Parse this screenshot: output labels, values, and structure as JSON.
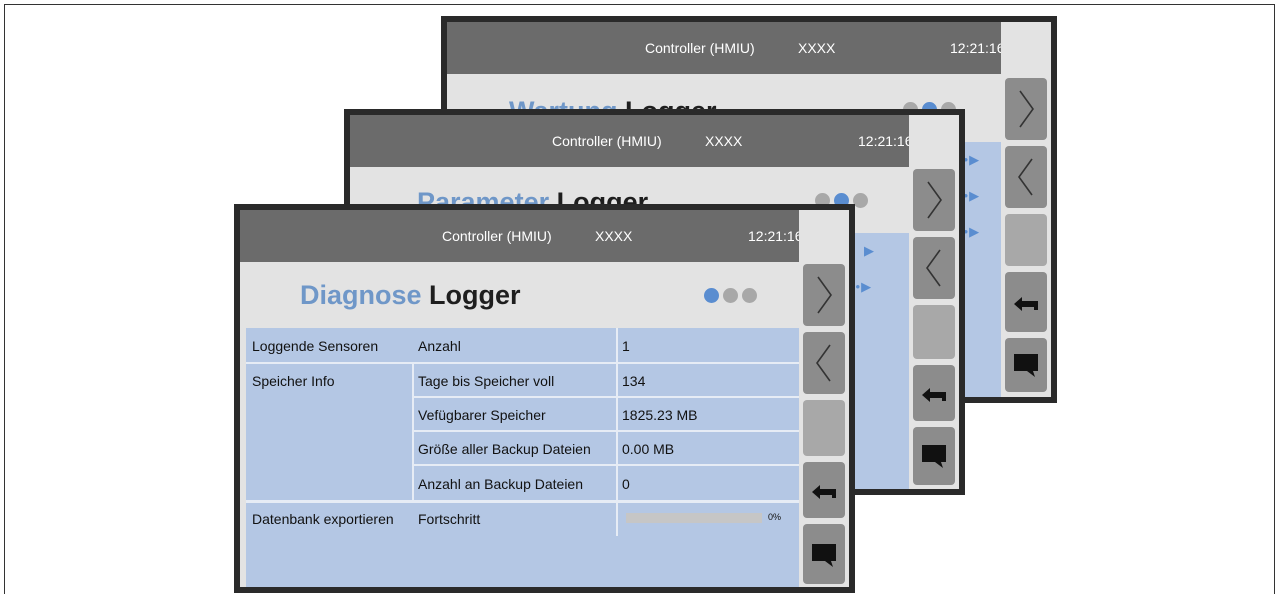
{
  "screens": {
    "back": {
      "header": {
        "controller": "Controller (HMIU)",
        "id": "XXXX",
        "time": "12:21:16"
      },
      "title_part1": "Wartung",
      "title_part2": "Logger",
      "page_indicator": {
        "count": 3,
        "active": 2
      }
    },
    "middle": {
      "header": {
        "controller": "Controller (HMIU)",
        "id": "XXXX",
        "time": "12:21:16"
      },
      "title_part1": "Parameter",
      "title_part2": "Logger",
      "page_indicator": {
        "count": 3,
        "active": 2
      }
    },
    "front": {
      "header": {
        "controller": "Controller (HMIU)",
        "id": "XXXX",
        "time": "12:21:16"
      },
      "title_part1": "Diagnose",
      "title_part2": "Logger",
      "page_indicator": {
        "count": 3,
        "active": 1
      },
      "table": {
        "groups": [
          {
            "label": "Loggende Sensoren",
            "rows": [
              {
                "field": "Anzahl",
                "value": "1"
              }
            ]
          },
          {
            "label": "Speicher Info",
            "rows": [
              {
                "field": "Tage bis Speicher voll",
                "value": "134"
              },
              {
                "field": "Vefügbarer Speicher",
                "value": "1825.23 MB"
              },
              {
                "field": "Größe aller Backup Dateien",
                "value": "0.00 MB"
              },
              {
                "field": "Anzahl an Backup Dateien",
                "value": "0"
              }
            ]
          },
          {
            "label": "Datenbank exportieren",
            "rows": [
              {
                "field": "Fortschritt",
                "progress": 0,
                "progress_label": "0%"
              }
            ]
          }
        ]
      }
    }
  },
  "nav_icons": [
    "chevron-right-icon",
    "chevron-left-icon",
    "back-arrow-icon",
    "speech-bubble-icon"
  ],
  "colors": {
    "header": "#6b6b6b",
    "title_accent": "#6f97c8",
    "table_bg": "#b4c7e4",
    "button": "#8c8c8c",
    "dot_active": "#5a8dd0"
  }
}
